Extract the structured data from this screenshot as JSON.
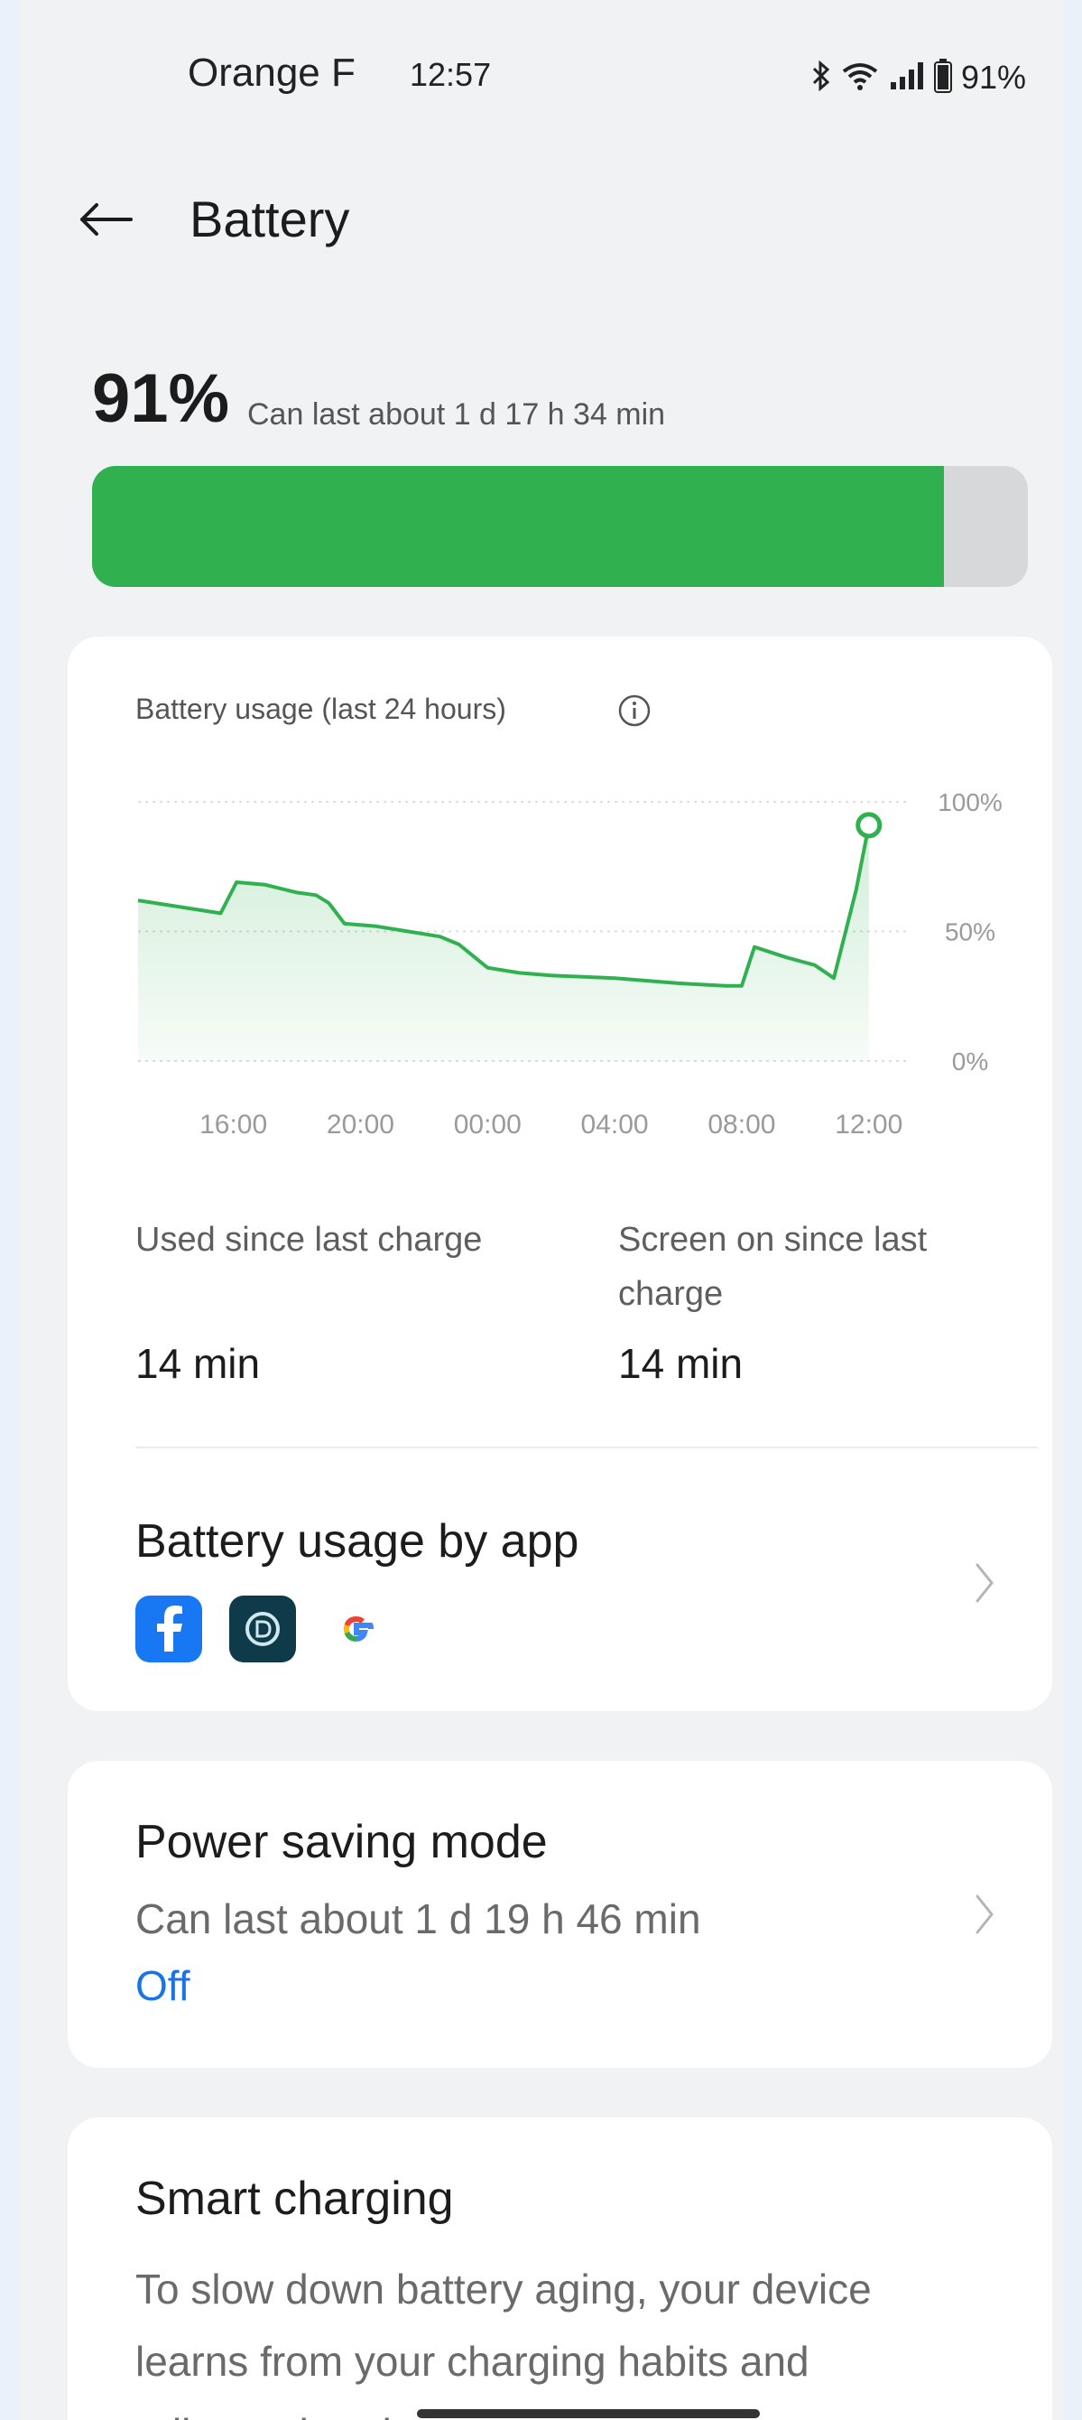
{
  "status_bar": {
    "carrier": "Orange F",
    "time": "12:57",
    "battery_pct": "91%",
    "icons": [
      "bluetooth-icon",
      "wifi-icon",
      "signal-icon",
      "battery-icon"
    ]
  },
  "header": {
    "title": "Battery"
  },
  "summary": {
    "percent": "91%",
    "remaining": "Can last about 1 d 17 h 34 min",
    "level": 0.91
  },
  "usage_card": {
    "chart_title": "Battery usage (last 24 hours)",
    "used_label": "Used since last charge",
    "used_value": "14 min",
    "screen_label": "Screen on since last charge",
    "screen_value": "14 min",
    "by_app_title": "Battery usage by app",
    "apps": [
      "facebook-icon",
      "app-d-icon",
      "google-icon"
    ]
  },
  "chart_data": {
    "type": "area",
    "title": "Battery usage (last 24 hours)",
    "x_ticks": [
      "16:00",
      "20:00",
      "00:00",
      "04:00",
      "08:00",
      "12:00"
    ],
    "y_ticks": [
      "100%",
      "50%",
      "0%"
    ],
    "ylim": [
      0,
      100
    ],
    "xlim_hours": [
      13,
      37.2
    ],
    "grid": true,
    "color": "#31b050",
    "series": [
      {
        "points": [
          [
            13.0,
            62
          ],
          [
            15.6,
            57
          ],
          [
            16.1,
            69
          ],
          [
            17.0,
            68
          ],
          [
            18.0,
            65
          ],
          [
            18.6,
            64
          ],
          [
            19.0,
            61
          ],
          [
            19.5,
            53
          ],
          [
            20.5,
            52
          ],
          [
            21.5,
            50
          ],
          [
            22.5,
            48
          ],
          [
            23.1,
            45
          ],
          [
            24.0,
            36
          ],
          [
            25.0,
            34
          ],
          [
            26.0,
            33
          ],
          [
            28.0,
            32
          ],
          [
            30.0,
            30
          ],
          [
            31.5,
            29
          ],
          [
            32.0,
            29
          ],
          [
            32.4,
            44
          ],
          [
            33.4,
            40
          ],
          [
            34.3,
            37
          ],
          [
            34.9,
            32
          ],
          [
            35.6,
            66
          ],
          [
            36.0,
            91
          ]
        ]
      }
    ]
  },
  "power_saving": {
    "title": "Power saving mode",
    "subtitle": "Can last about 1 d 19 h 46 min",
    "state": "Off"
  },
  "smart_charging": {
    "title": "Smart charging",
    "description": "To slow down battery aging, your device learns from your charging habits and adjusts charging"
  }
}
